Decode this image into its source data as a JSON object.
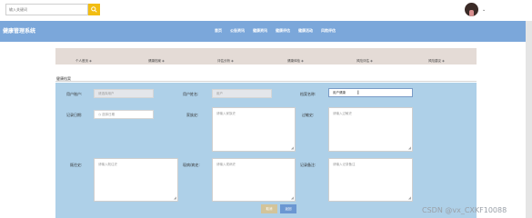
{
  "topbar": {
    "search_placeholder": "输入关键词"
  },
  "brand": "健康管理系统",
  "nav": [
    "首页",
    "公告资讯",
    "健康资讯",
    "健康评估",
    "健康活动",
    "风险评估"
  ],
  "tabs": [
    "个人首页",
    "健康档案",
    "评估分析",
    "健康体检",
    "风险评估",
    "风险建议"
  ],
  "section_title": "健康档案",
  "form": {
    "user_account_label": "用户账户:",
    "user_account_value": "请选择用户",
    "user_name_label": "用户姓名:",
    "user_name_value": "用户",
    "archive_name_label": "档案名称:",
    "archive_name_value": "用户健康",
    "record_date_label": "记录日期:",
    "record_date_value": "选择日期",
    "family_history_label": "家族史:",
    "family_history_placeholder": "请输入家族史",
    "allergy_history_label": "过敏史:",
    "allergy_history_placeholder": "请输入过敏史",
    "past_history_label": "既往史:",
    "past_history_placeholder": "请输入既往史",
    "current_disease_label": "现病/病史:",
    "current_disease_placeholder": "请输入现病史",
    "record_note_label": "记录备注:",
    "record_note_placeholder": "请输入记录备注"
  },
  "buttons": {
    "cancel": "取消",
    "return": "返回"
  },
  "watermark": "CSDN @vx_CXKF10088"
}
